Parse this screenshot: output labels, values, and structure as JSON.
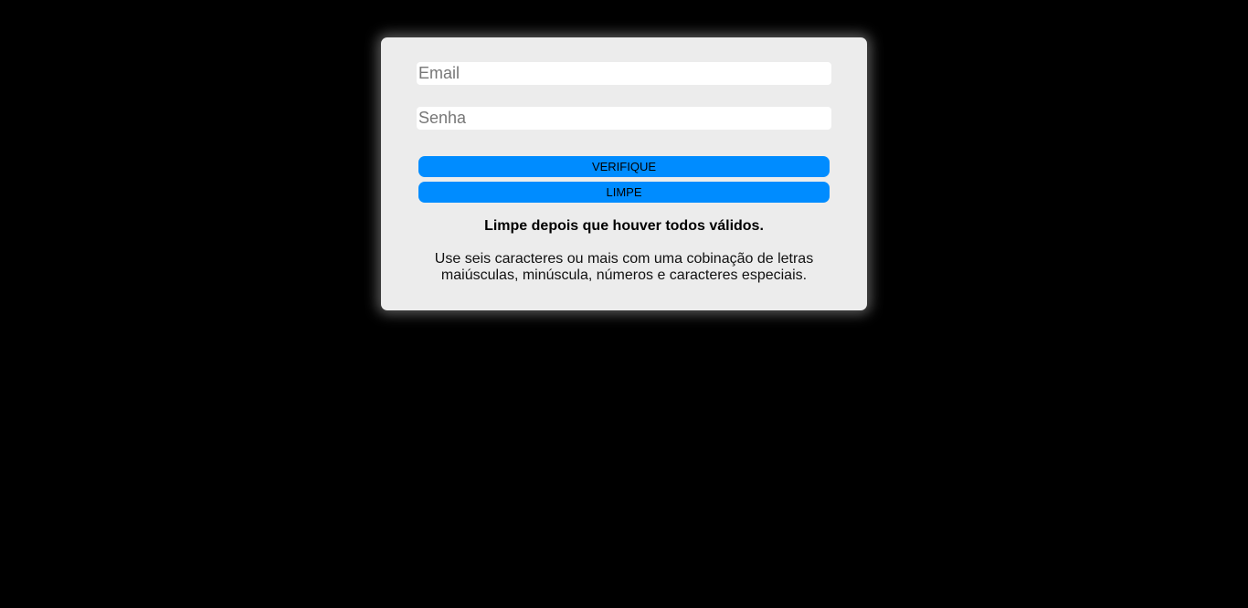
{
  "form": {
    "email_placeholder": "Email",
    "password_placeholder": "Senha",
    "verify_label": "VERIFIQUE",
    "clear_label": "LIMPE",
    "clear_hint": "Limpe depois que houver todos válidos.",
    "password_rule": "Use seis caracteres ou mais com uma cobinação de letras maiúsculas, minúscula, números e caracteres especiais."
  },
  "colors": {
    "background": "#000000",
    "card": "#ececec",
    "button": "#008cff"
  }
}
